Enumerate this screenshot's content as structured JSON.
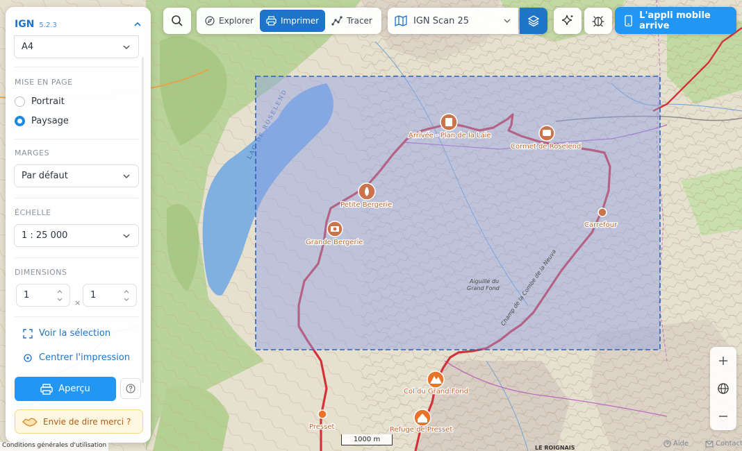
{
  "app": {
    "brand": "IGN",
    "version": "5.2.3"
  },
  "print_panel": {
    "format": "A4",
    "layout": {
      "title": "MISE EN PAGE",
      "options": [
        "Portrait",
        "Paysage"
      ],
      "selected": "Paysage"
    },
    "margins": {
      "title": "MARGES",
      "value": "Par défaut"
    },
    "scale": {
      "title": "ÉCHELLE",
      "value": "1 : 25 000"
    },
    "dimensions": {
      "title": "DIMENSIONS",
      "cols": "1",
      "rows": "1",
      "separator": "×"
    },
    "actions": {
      "view_selection": "Voir la sélection",
      "center_print": "Centrer l'impression"
    },
    "preview_button": "Aperçu",
    "thanks_button": "Envie de dire merci ?"
  },
  "toolbar": {
    "modes": [
      "Explorer",
      "Imprimer",
      "Tracer"
    ],
    "active_mode": "Imprimer",
    "basemap": "IGN Scan 25",
    "mobile_banner": "L'appli mobile arrive"
  },
  "map": {
    "pois": [
      {
        "label": "Arrivée - Plan de la Laie",
        "icon": "shelter-icon"
      },
      {
        "label": "Cormet de Roselend",
        "icon": "bus-icon"
      },
      {
        "label": "Petite Bergerie",
        "icon": "water-icon"
      },
      {
        "label": "Grande Bergerie",
        "icon": "camera-icon"
      },
      {
        "label": "Carrefour",
        "icon": "waypoint-icon"
      },
      {
        "label": "Col du Grand Fond",
        "icon": "pass-icon"
      },
      {
        "label": "Presset",
        "icon": "waypoint-icon"
      },
      {
        "label": "Refuge de Presset",
        "icon": "hut-icon"
      }
    ],
    "terrain_labels": [
      "Aiguille du Grand Fond",
      "Champ de la Combe de la Neuva",
      "LE ROIGNAIS",
      "Lac de Roselend"
    ],
    "scale_label": "1000 m",
    "colors": {
      "route": "#d4323a",
      "print_area_fill": "#8f9fe6",
      "print_area_border": "#2a62b5",
      "poi": "#c9744a",
      "lake": "#7fb0df"
    }
  },
  "footer": {
    "terms": "Conditions générales d'utilisation",
    "help": "Aide",
    "contact": "Contact"
  }
}
